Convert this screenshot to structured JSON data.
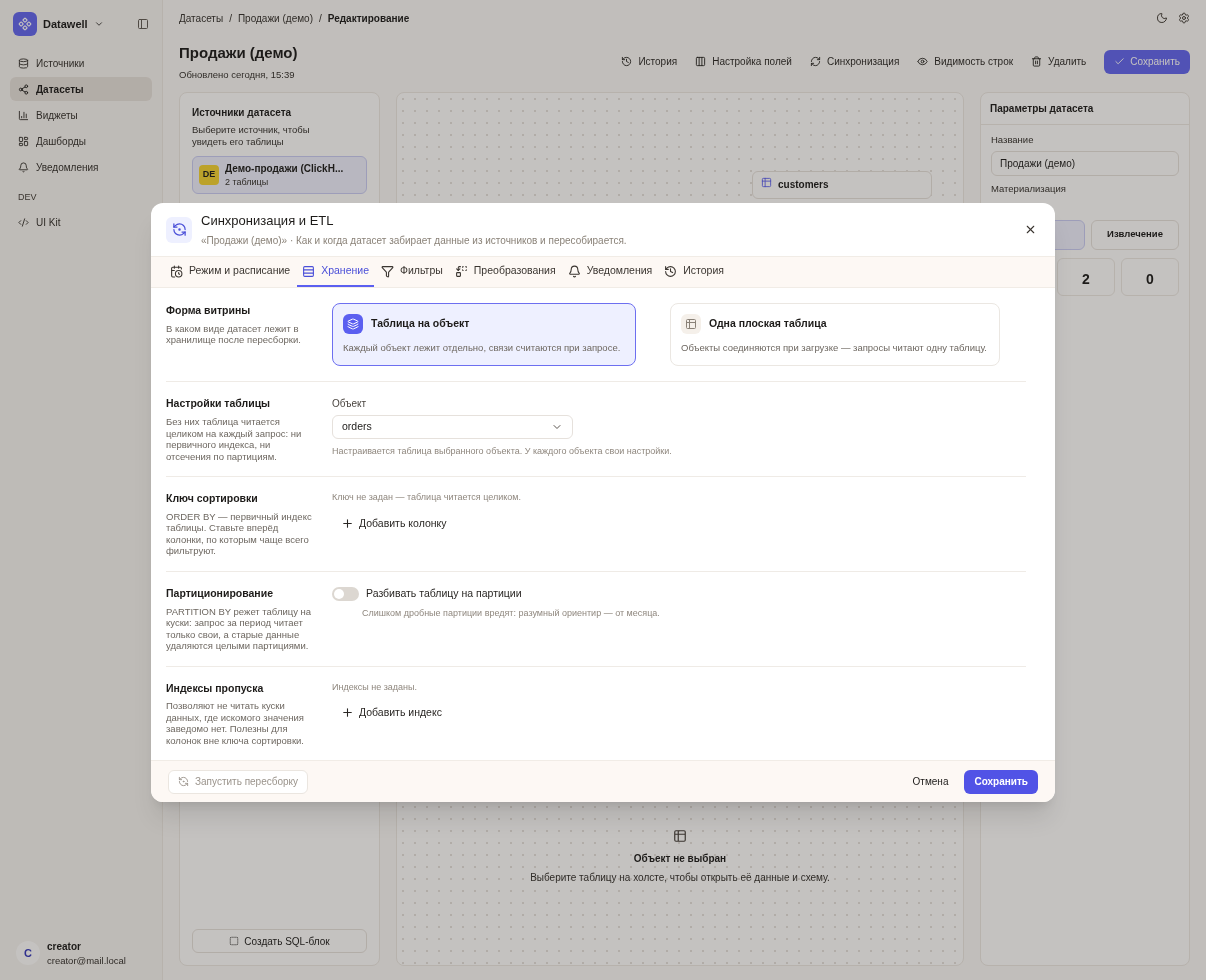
{
  "sidebar": {
    "brand": "Datawell",
    "items": [
      {
        "label": "Источники",
        "selected": false
      },
      {
        "label": "Датасеты",
        "selected": true
      },
      {
        "label": "Виджеты",
        "selected": false
      },
      {
        "label": "Дашборды",
        "selected": false
      },
      {
        "label": "Уведомления",
        "selected": false
      }
    ],
    "section": "DEV",
    "dev_items": [
      {
        "label": "UI Kit",
        "selected": false
      }
    ],
    "user": {
      "initial": "C",
      "name": "creator",
      "email": "creator@mail.local"
    }
  },
  "header": {
    "breadcrumbs": [
      {
        "kind": "link",
        "label": "Датасеты"
      },
      {
        "kind": "separator",
        "label": "/"
      },
      {
        "kind": "link",
        "label": "Продажи (демо)"
      },
      {
        "kind": "separator",
        "label": "/"
      },
      {
        "kind": "current",
        "label": "Редактирование"
      }
    ],
    "title": "Продажи (демо)",
    "subtitle": "Обновлено сегодня, 15:39",
    "actions": [
      "История",
      "Настройка полей",
      "Синхронизация",
      "Видимость строк",
      "Удалить"
    ],
    "save": "Сохранить"
  },
  "sources": {
    "title": "Источники датасета",
    "hint": "Выберите источник, чтобы увидеть его таблицы",
    "source": {
      "badge": "DE",
      "name": "Демо-продажи (ClickH...",
      "meta": "2 таблицы"
    },
    "sql_button": "Создать SQL-блок"
  },
  "canvas": {
    "node": {
      "title": "customers"
    },
    "empty": {
      "title": "Объект не выбран",
      "text": "Выберите таблицу на холсте, чтобы открыть её данные и схему."
    }
  },
  "params": {
    "title": "Параметры датасета",
    "name_label": "Название",
    "name_value": "Продажи (демо)",
    "mat_label": "Материализация",
    "mat_option": "Извлечение",
    "stats": [
      "2",
      "0"
    ]
  },
  "modal": {
    "title": "Синхронизация и ETL",
    "subtitle": "«Продажи (демо)» · Как и когда датасет забирает данные из источников и пересобирается.",
    "tabs": [
      {
        "label": "Режим и расписание",
        "selected": false
      },
      {
        "label": "Хранение",
        "selected": true
      },
      {
        "label": "Фильтры",
        "selected": false
      },
      {
        "label": "Преобразования",
        "selected": false
      },
      {
        "label": "Уведомления",
        "selected": false
      },
      {
        "label": "История",
        "selected": false
      }
    ],
    "sections": [
      {
        "kind": "choice",
        "title": "Форма витрины",
        "text": "В каком виде датасет лежит в хранилище после пересборки.",
        "options": [
          {
            "title": "Таблица на объект",
            "text": "Каждый объект лежит отдельно, связи считаются при запросе.",
            "selected": true
          },
          {
            "title": "Одна плоская таблица",
            "text": "Объекты соединяются при загрузке — запросы читают одну таблицу.",
            "selected": false
          }
        ]
      },
      {
        "kind": "select",
        "title": "Настройки таблицы",
        "text": "Без них таблица читается целиком на каждый запрос: ни первичного индекса, ни отсечения по партициям.",
        "label": "Объект",
        "value": "orders",
        "hint": "Настраивается таблица выбранного объекта. У каждого объекта свои настройки."
      },
      {
        "kind": "list",
        "title": "Ключ сортировки",
        "text": "ORDER BY — первичный индекс таблицы. Ставьте вперёд колонки, по которым чаще всего фильтруют.",
        "empty": "Ключ не задан — таблица читается целиком.",
        "add": "Добавить колонку"
      },
      {
        "kind": "toggle",
        "title": "Партиционирование",
        "text": "PARTITION BY режет таблицу на куски: запрос за период читает только свои, а старые данные удаляются целыми партициями.",
        "label": "Разбивать таблицу на партиции",
        "on": false,
        "hint": "Слишком дробные партиции вредят: разумный ориентир — от месяца."
      },
      {
        "kind": "list",
        "title": "Индексы пропуска",
        "text": "Позволяют не читать куски данных, где искомого значения заведомо нет. Полезны для колонок вне ключа сортировки.",
        "empty": "Индексы не заданы.",
        "add": "Добавить индекс"
      }
    ],
    "run": {
      "label": "Запустить пересборку",
      "disabled": true
    },
    "cancel": "Отмена",
    "save": "Сохранить"
  }
}
